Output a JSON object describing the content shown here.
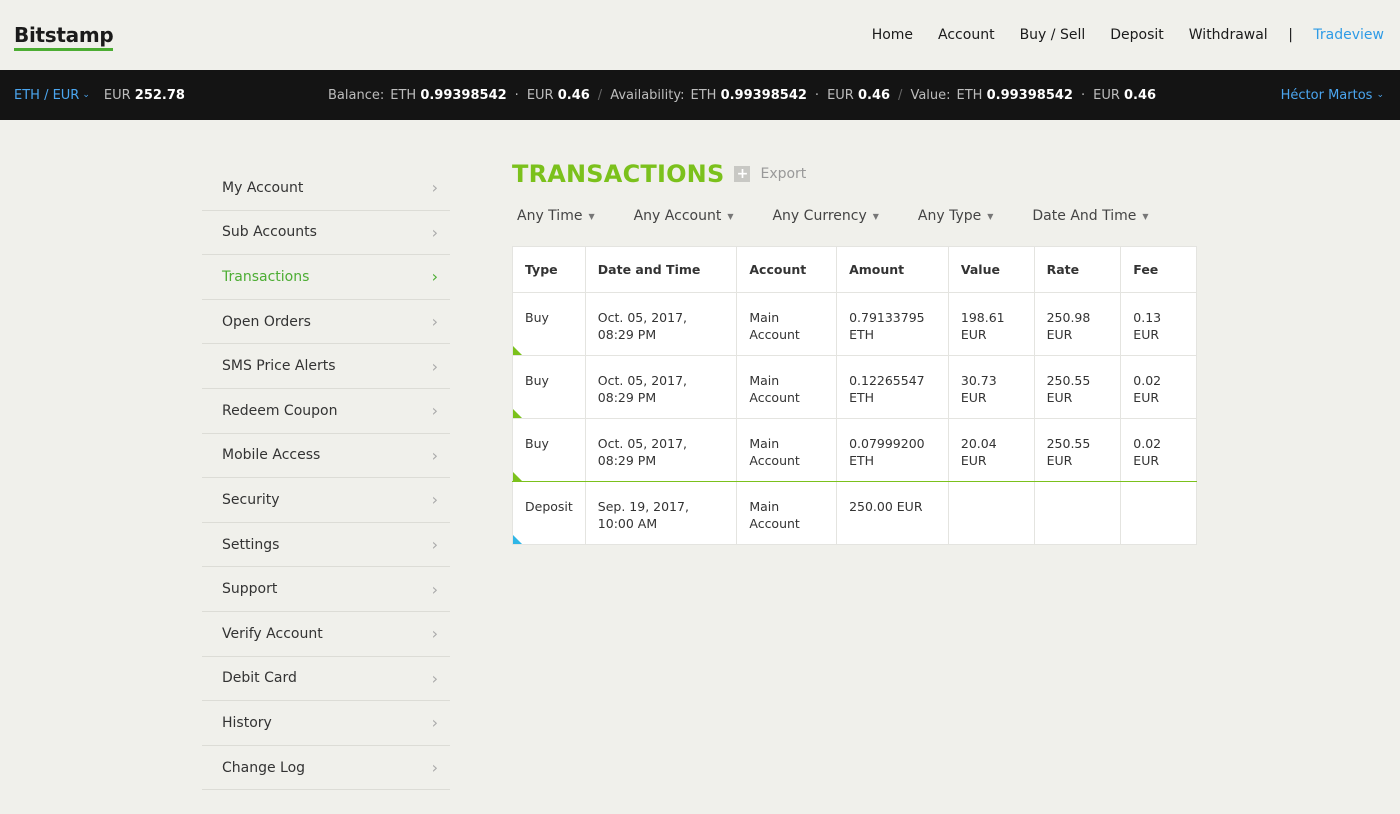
{
  "header": {
    "logo": "Bitstamp",
    "nav": [
      "Home",
      "Account",
      "Buy / Sell",
      "Deposit",
      "Withdrawal"
    ],
    "separator": "|",
    "tradeview": "Tradeview"
  },
  "bar": {
    "pair": "ETH / EUR",
    "price_currency": "EUR",
    "price_value": "252.78",
    "balance_label": "Balance:",
    "balance_eth_cur": "ETH",
    "balance_eth": "0.99398542",
    "balance_eur_cur": "EUR",
    "balance_eur": "0.46",
    "availability_label": "Availability:",
    "avail_eth_cur": "ETH",
    "avail_eth": "0.99398542",
    "avail_eur_cur": "EUR",
    "avail_eur": "0.46",
    "value_label": "Value:",
    "value_eth_cur": "ETH",
    "value_eth": "0.99398542",
    "value_eur_cur": "EUR",
    "value_eur": "0.46",
    "user": "Héctor Martos"
  },
  "sidebar": {
    "items": [
      {
        "label": "My Account"
      },
      {
        "label": "Sub Accounts"
      },
      {
        "label": "Transactions"
      },
      {
        "label": "Open Orders"
      },
      {
        "label": "SMS Price Alerts"
      },
      {
        "label": "Redeem Coupon"
      },
      {
        "label": "Mobile Access"
      },
      {
        "label": "Security"
      },
      {
        "label": "Settings"
      },
      {
        "label": "Support"
      },
      {
        "label": "Verify Account"
      },
      {
        "label": "Debit Card"
      },
      {
        "label": "History"
      },
      {
        "label": "Change Log"
      }
    ],
    "active_index": 2
  },
  "main": {
    "title": "TRANSACTIONS",
    "export": "Export",
    "filters": [
      "Any Time",
      "Any Account",
      "Any Currency",
      "Any Type",
      "Date And Time"
    ],
    "columns": [
      "Type",
      "Date and Time",
      "Account",
      "Amount",
      "Value",
      "Rate",
      "Fee"
    ],
    "rows": [
      {
        "type": "Buy",
        "date": "Oct. 05, 2017, 08:29 PM",
        "account": "Main Account",
        "amount": "0.79133795 ETH",
        "value": "198.61 EUR",
        "rate": "250.98 EUR",
        "fee": "0.13 EUR",
        "marker": "green"
      },
      {
        "type": "Buy",
        "date": "Oct. 05, 2017, 08:29 PM",
        "account": "Main Account",
        "amount": "0.12265547 ETH",
        "value": "30.73 EUR",
        "rate": "250.55 EUR",
        "fee": "0.02 EUR",
        "marker": "green"
      },
      {
        "type": "Buy",
        "date": "Oct. 05, 2017, 08:29 PM",
        "account": "Main Account",
        "amount": "0.07999200 ETH",
        "value": "20.04 EUR",
        "rate": "250.55 EUR",
        "fee": "0.02 EUR",
        "marker": "green"
      },
      {
        "type": "Deposit",
        "date": "Sep. 19, 2017, 10:00 AM",
        "account": "Main Account",
        "amount": "250.00 EUR",
        "value": "",
        "rate": "",
        "fee": "",
        "marker": "blue"
      }
    ]
  },
  "colors": {
    "accent_green": "#7bc11c",
    "link_blue": "#2e9be6",
    "bar_bg": "#141414"
  }
}
